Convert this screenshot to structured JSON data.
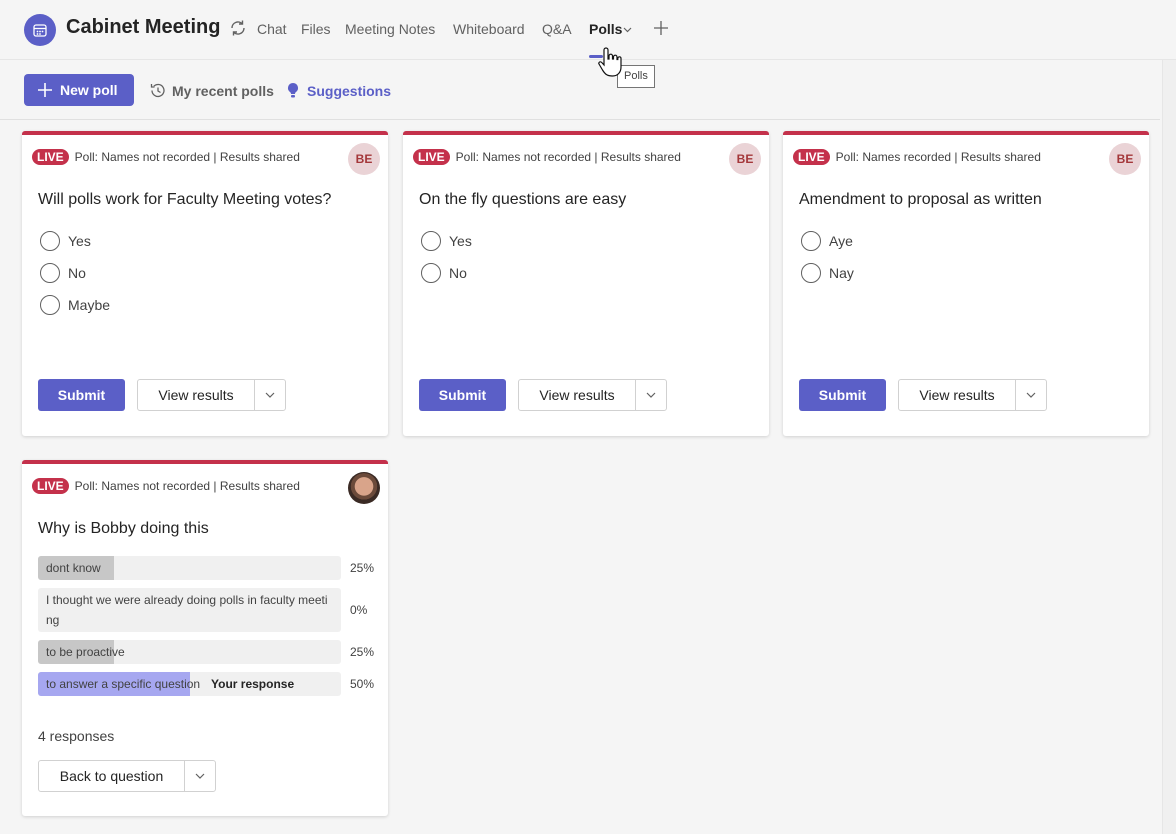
{
  "header": {
    "title": "Cabinet Meeting",
    "tabs": [
      "Chat",
      "Files",
      "Meeting Notes",
      "Whiteboard",
      "Q&A",
      "Polls"
    ],
    "tooltip": "Polls"
  },
  "toolbar": {
    "new_poll": "New poll",
    "recent": "My recent polls",
    "suggestions": "Suggestions"
  },
  "colors": {
    "accent": "#5b5fc7",
    "live": "#c4314b"
  },
  "polls": [
    {
      "badge": "LIVE",
      "meta": "Poll: Names not recorded | Results shared",
      "avatar": "BE",
      "question": "Will polls work for Faculty Meeting votes?",
      "options": [
        "Yes",
        "No",
        "Maybe"
      ],
      "submit": "Submit",
      "view_results": "View results"
    },
    {
      "badge": "LIVE",
      "meta": "Poll: Names not recorded | Results shared",
      "avatar": "BE",
      "question": "On the fly questions are easy",
      "options": [
        "Yes",
        "No"
      ],
      "submit": "Submit",
      "view_results": "View results"
    },
    {
      "badge": "LIVE",
      "meta": "Poll: Names recorded | Results shared",
      "avatar": "BE",
      "question": "Amendment to proposal as written",
      "options": [
        "Aye",
        "Nay"
      ],
      "submit": "Submit",
      "view_results": "View results"
    },
    {
      "badge": "LIVE",
      "meta": "Poll: Names not recorded | Results shared",
      "question": "Why is Bobby doing this",
      "results": [
        {
          "label": "dont know",
          "percent": "25%",
          "value": 0.25
        },
        {
          "label": "I thought we were already doing polls in faculty meeting",
          "percent": "0%",
          "value": 0
        },
        {
          "label": "to be proactive",
          "percent": "25%",
          "value": 0.25
        },
        {
          "label": "to answer a specific question",
          "percent": "50%",
          "value": 0.5,
          "mine": true,
          "tag": "Your response"
        }
      ],
      "responses": "4 responses",
      "back": "Back to question"
    }
  ]
}
